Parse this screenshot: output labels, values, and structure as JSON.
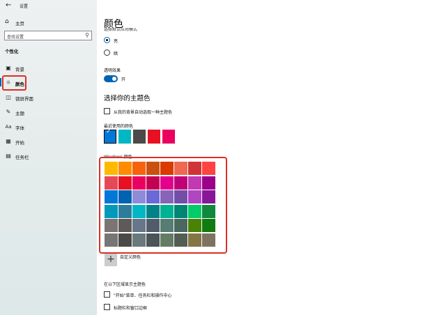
{
  "app": {
    "title": "设置",
    "back_icon": "back-arrow-icon"
  },
  "sidebar": {
    "home_label": "主页",
    "search_placeholder": "查找设置",
    "section_title": "个性化",
    "items": [
      {
        "label": "背景",
        "icon": "picture-icon",
        "active": false
      },
      {
        "label": "颜色",
        "icon": "palette-icon",
        "active": true
      },
      {
        "label": "锁屏界面",
        "icon": "lock-screen-icon",
        "active": false
      },
      {
        "label": "主题",
        "icon": "theme-icon",
        "active": false
      },
      {
        "label": "字体",
        "icon": "font-icon",
        "active": false
      },
      {
        "label": "开始",
        "icon": "start-icon",
        "active": false
      },
      {
        "label": "任务栏",
        "icon": "taskbar-icon",
        "active": false
      }
    ]
  },
  "main": {
    "title": "颜色",
    "app_mode_label": "选择默认应用模式",
    "modes": [
      {
        "label": "亮",
        "selected": true
      },
      {
        "label": "暗",
        "selected": false
      }
    ],
    "transparency": {
      "label": "透明效果",
      "state_label": "开",
      "on": true
    },
    "theme_color_title": "选择你的主题色",
    "auto_accent_label": "从我的背景自动选取一种主题色",
    "recent_label": "最近使用的颜色",
    "recent_colors": [
      "#0078d7",
      "#00b7c3",
      "#4c4a48",
      "#e81123",
      "#ea005e"
    ],
    "windows_colors_label": "Windows 颜色",
    "windows_colors": [
      [
        "#ffb900",
        "#ff8c00",
        "#f7630c",
        "#ca5010",
        "#da3b01",
        "#ef6950",
        "#d13438",
        "#ff4343"
      ],
      [
        "#e74856",
        "#e81123",
        "#ea005e",
        "#c30052",
        "#e3008c",
        "#bf0077",
        "#c239b3",
        "#9a0089"
      ],
      [
        "#0078d7",
        "#0063b1",
        "#8e8cd8",
        "#6b69d6",
        "#8764b8",
        "#744da9",
        "#b146c2",
        "#881798"
      ],
      [
        "#0099bc",
        "#2d7d9a",
        "#00b7c3",
        "#038387",
        "#00b294",
        "#018574",
        "#00cc6a",
        "#10893e"
      ],
      [
        "#7a7574",
        "#5d5a58",
        "#68768a",
        "#515c6b",
        "#567c73",
        "#486860",
        "#498205",
        "#107c10"
      ],
      [
        "#767676",
        "#4c4a48",
        "#69797e",
        "#4a5459",
        "#647c64",
        "#525e54",
        "#847545",
        "#7e735f"
      ]
    ],
    "custom_color_label": "自定义颜色",
    "show_accent_title": "在以下区域显示主题色",
    "show_accent_options": [
      "\"开始\"菜单、任务栏和操作中心",
      "标题栏和窗口边框"
    ]
  }
}
